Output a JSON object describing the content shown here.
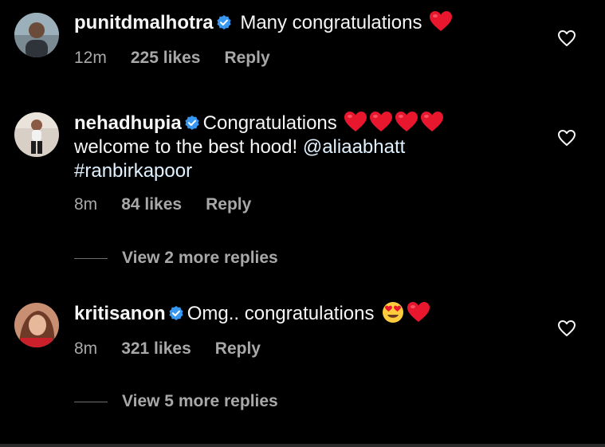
{
  "comments": [
    {
      "username": "punitdmalhotra",
      "text": "Many congratulations",
      "emojis": [
        "red-heart"
      ],
      "time": "12m",
      "likes": "225 likes",
      "reply_label": "Reply"
    },
    {
      "username": "nehadhupia",
      "text": "Congratulations",
      "emojis": [
        "red-heart",
        "red-heart",
        "red-heart",
        "red-heart"
      ],
      "line2": "welcome to the best hood!",
      "mention": "@aliaabhatt",
      "hashtag": "#ranbirkapoor",
      "time": "8m",
      "likes": "84 likes",
      "reply_label": "Reply",
      "view_replies": "View 2 more replies"
    },
    {
      "username": "kritisanon",
      "text": "Omg.. congratulations",
      "emojis": [
        "heart-eyes-face",
        "red-heart"
      ],
      "time": "8m",
      "likes": "321 likes",
      "reply_label": "Reply",
      "view_replies": "View 5 more replies"
    }
  ],
  "colors": {
    "background": "#000000",
    "primary_text": "#f5f5f5",
    "secondary_text": "#a8a8a8",
    "verified_badge": "#3897f0",
    "heart": "#e8172d"
  },
  "icons": {
    "verified": "verified-badge-icon",
    "like": "heart-outline-icon"
  }
}
